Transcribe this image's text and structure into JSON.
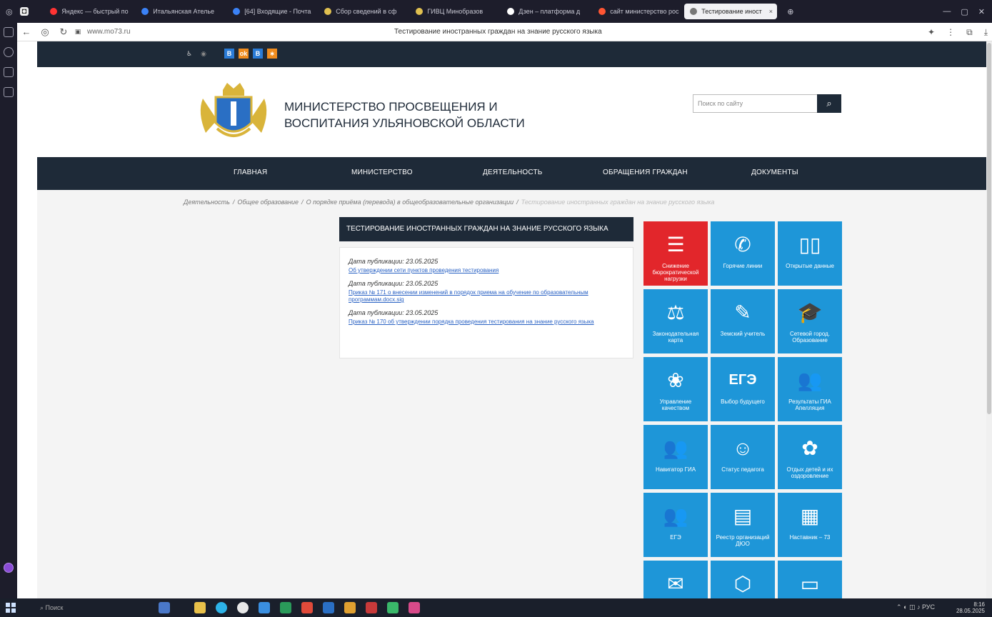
{
  "browser": {
    "tabs": [
      {
        "label": "Яндекс — быстрый по",
        "color": "#ff3333"
      },
      {
        "label": "Итальянская Ателье",
        "color": "#3b82f6"
      },
      {
        "label": "[64] Входящие - Почта",
        "color": "#3b82f6"
      },
      {
        "label": "Сбор сведений в сф",
        "color": "#e0c050"
      },
      {
        "label": "ГИВЦ Минобразов",
        "color": "#e0c050"
      },
      {
        "label": "Дзен – платформа д",
        "color": "#ffffff"
      },
      {
        "label": "сайт министерство рос",
        "color": "#ff5533"
      },
      {
        "label": "Тестирование иност",
        "color": "#777777",
        "active": true
      }
    ],
    "url": "www.mo73.ru",
    "page_title": "Тестирование иностранных граждан на знание русского языка"
  },
  "site": {
    "header": {
      "title_line1": "МИНИСТЕРСТВО ПРОСВЕЩЕНИЯ И",
      "title_line2": "ВОСПИТАНИЯ УЛЬЯНОВСКОЙ ОБЛАСТИ",
      "search_placeholder": "Поиск по сайту"
    },
    "social": [
      "В",
      "В"
    ],
    "nav": [
      {
        "label": "ГЛАВНАЯ"
      },
      {
        "label": "МИНИСТЕРСТВО"
      },
      {
        "label": "ДЕЯТЕЛЬНОСТЬ"
      },
      {
        "label": "ОБРАЩЕНИЯ ГРАЖДАН"
      },
      {
        "label": "ДОКУМЕНТЫ"
      }
    ],
    "breadcrumb": {
      "item1": "Деятельность",
      "item2": "Общее образование",
      "item3": "О порядке приёма (перевода) в общеобразовательные организации",
      "current": "Тестирование иностранных граждан на знание русского языка"
    },
    "article": {
      "title": "ТЕСТИРОВАНИЕ ИНОСТРАННЫХ ГРАЖДАН НА ЗНАНИЕ РУССКОГО ЯЗЫКА",
      "publications": [
        {
          "date": "Дата публикации: 23.05.2025",
          "link": "Об утверждении сети пунктов проведения тестирования"
        },
        {
          "date": "Дата публикации: 23.05.2025",
          "link": "Приказ № 171 о внесении изменений в порядок приема на обучение по образовательным программам.docx.sig"
        },
        {
          "date": "Дата публикации: 23.05.2025",
          "link": "Приказ № 170 об утверждении порядка проведения тестирования на знание русского языка"
        }
      ]
    },
    "tiles": [
      {
        "label": "Снижение бюрократической нагрузки",
        "icon": "briefcase-icon",
        "color": "#e2262b"
      },
      {
        "label": "Горячие линии",
        "icon": "phone-icon",
        "color": "#1e96d8"
      },
      {
        "label": "Открытые данные",
        "icon": "book-icon",
        "color": "#1e96d8"
      },
      {
        "label": "Законодательная карта",
        "icon": "gavel-icon",
        "color": "#1e96d8"
      },
      {
        "label": "Земский учитель",
        "icon": "teacher-icon",
        "color": "#1e96d8"
      },
      {
        "label": "Сетевой город. Образование",
        "icon": "graduation-cap-icon",
        "color": "#1e96d8"
      },
      {
        "label": "Управление качеством",
        "icon": "quality-icon",
        "color": "#1e96d8"
      },
      {
        "label": "Выбор будущего",
        "icon": "ege-icon",
        "color": "#1e96d8",
        "big": "ЕГЭ"
      },
      {
        "label": "Результаты ГИА Апелляция",
        "icon": "people-icon",
        "color": "#1e96d8"
      },
      {
        "label": "Навигатор ГИА",
        "icon": "people-icon",
        "color": "#1e96d8"
      },
      {
        "label": "Статус педагога",
        "icon": "teacher-status-icon",
        "color": "#1e96d8"
      },
      {
        "label": "Отдых детей и их оздоровление",
        "icon": "children-icon",
        "color": "#1e96d8"
      },
      {
        "label": "ЕГЭ",
        "icon": "people-icon",
        "color": "#1e96d8"
      },
      {
        "label": "Реестр организаций ДЮО",
        "icon": "clipboard-icon",
        "color": "#1e96d8"
      },
      {
        "label": "Наставник – 73",
        "icon": "school-icon",
        "color": "#1e96d8"
      },
      {
        "label": "",
        "icon": "mail-icon",
        "color": "#1e96d8"
      },
      {
        "label": "",
        "icon": "cubes-icon",
        "color": "#1e96d8"
      },
      {
        "label": "",
        "icon": "document-icon",
        "color": "#1e96d8"
      }
    ]
  },
  "taskbar": {
    "search": "Поиск",
    "tray_lang": "РУС",
    "time": "8:16",
    "date": "28.05.2025"
  }
}
